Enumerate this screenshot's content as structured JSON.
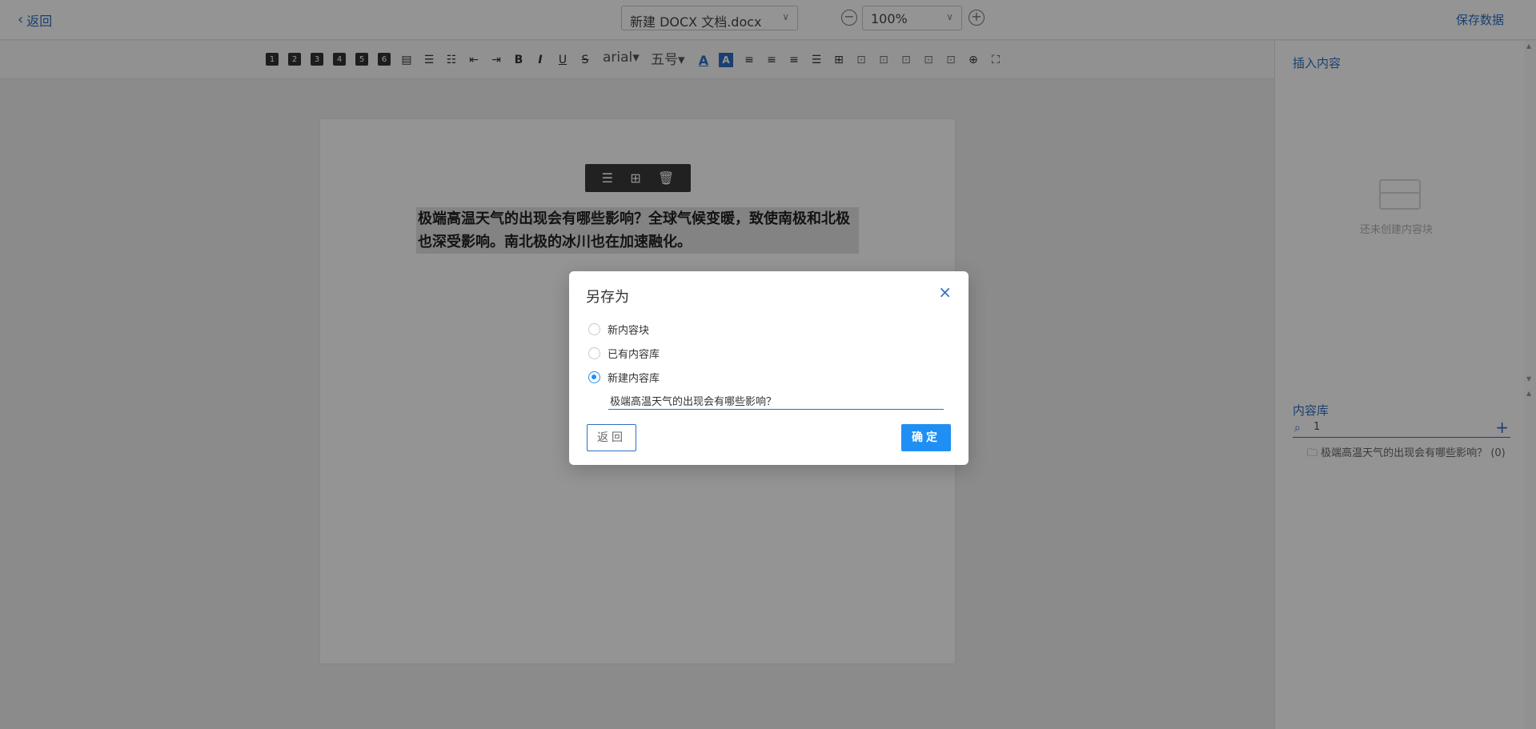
{
  "topbar": {
    "back_label": "返回",
    "file_name": "新建 DOCX 文档.docx",
    "zoom": "100%",
    "save_label": "保存数据"
  },
  "toolbar": {
    "headings": [
      "1",
      "2",
      "3",
      "4",
      "5",
      "6"
    ],
    "font_family": "arial▾",
    "font_size": "五号▾",
    "bold": "B",
    "italic": "I",
    "underline": "U",
    "strike": "S",
    "font_color": "A",
    "bg_color": "A"
  },
  "editor": {
    "block_text": "极端高温天气的出现会有哪些影响？全球气候变暖，致使南极和北极也深受影响。南北极的冰川也在加速融化。"
  },
  "right_panel": {
    "insert_title": "插入内容",
    "empty_text": "还未创建内容块",
    "library_title": "内容库",
    "search_value": "1",
    "library_items": [
      {
        "name": "极端高温天气的出现会有哪些影响？",
        "count": "(0)"
      }
    ]
  },
  "dialog": {
    "title": "另存为",
    "options": [
      {
        "label": "新内容块",
        "checked": false
      },
      {
        "label": "已有内容库",
        "checked": false
      },
      {
        "label": "新建内容库",
        "checked": true
      }
    ],
    "name_value": "极端高温天气的出现会有哪些影响？",
    "back_label": "返回",
    "ok_label": "确定"
  },
  "colors": {
    "accent": "#2d6fc3",
    "primary_button": "#1f8ff3"
  }
}
